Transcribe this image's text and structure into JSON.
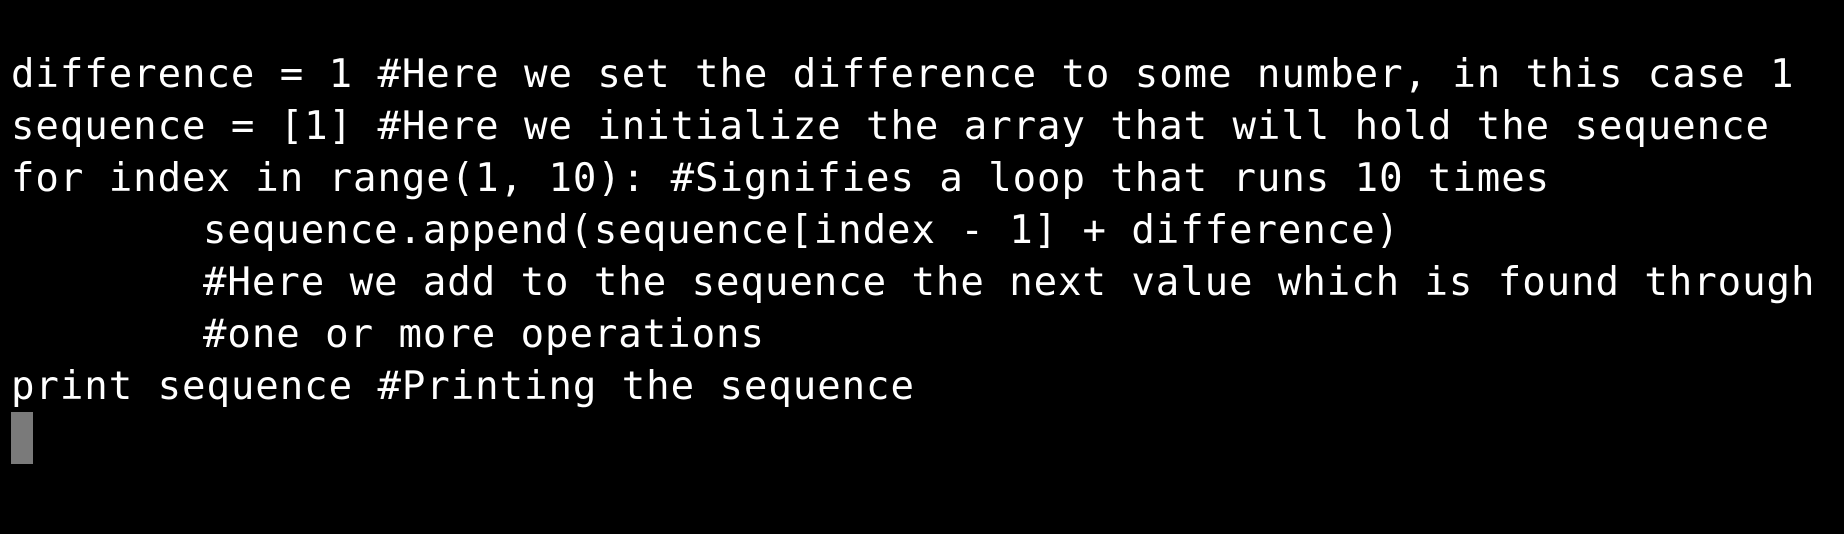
{
  "terminal": {
    "lines": [
      "difference = 1 #Here we set the difference to some number, in this case 1",
      "sequence = [1] #Here we initialize the array that will hold the sequence",
      "for index in range(1, 10): #Signifies a loop that runs 10 times",
      "sequence.append(sequence[index - 1] + difference)",
      "#Here we add to the sequence the next value which is found through",
      "#one or more operations",
      "print sequence #Printing the sequence"
    ]
  },
  "colors": {
    "background": "#000000",
    "text": "#ffffff",
    "cursor": "#7a7a7a"
  }
}
